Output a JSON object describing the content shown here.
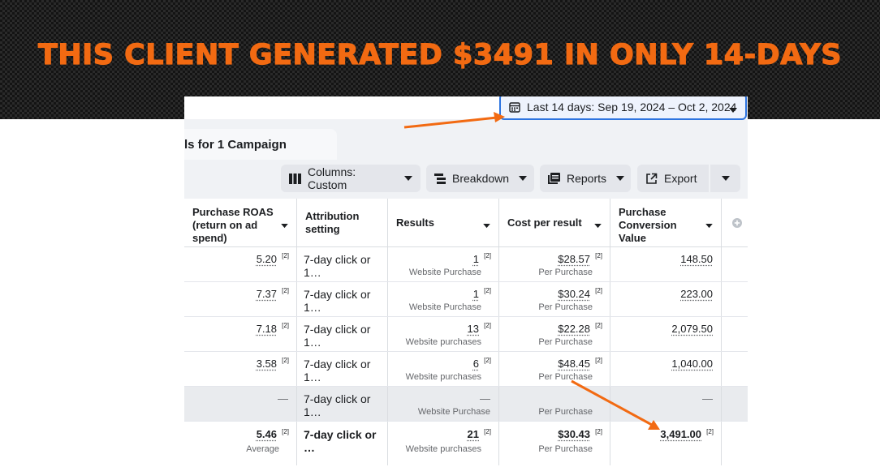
{
  "headline": "THIS CLIENT GENERATED $3491 IN ONLY 14-DAYS",
  "date_range": {
    "label": "Last 14 days: Sep 19, 2024 – Oct 2, 2024"
  },
  "tab": {
    "label": "ls for 1 Campaign"
  },
  "toolbar": {
    "columns_label": "Columns: Custom",
    "breakdown_label": "Breakdown",
    "reports_label": "Reports",
    "export_label": "Export"
  },
  "table": {
    "headers": [
      "Purchase ROAS (return on ad spend)",
      "Attribution setting",
      "Results",
      "Cost per result",
      "Purchase Conversion Value"
    ],
    "footnote_marker": "[2]",
    "rows": [
      {
        "roas": "5.20",
        "attribution": "7-day click or 1…",
        "results": "1",
        "results_sub": "Website Purchase",
        "cost": "$28.57",
        "cost_sub": "Per Purchase",
        "value": "148.50"
      },
      {
        "roas": "7.37",
        "attribution": "7-day click or 1…",
        "results": "1",
        "results_sub": "Website Purchase",
        "cost": "$30.24",
        "cost_sub": "Per Purchase",
        "value": "223.00"
      },
      {
        "roas": "7.18",
        "attribution": "7-day click or 1…",
        "results": "13",
        "results_sub": "Website purchases",
        "cost": "$22.28",
        "cost_sub": "Per Purchase",
        "value": "2,079.50"
      },
      {
        "roas": "3.58",
        "attribution": "7-day click or 1…",
        "results": "6",
        "results_sub": "Website purchases",
        "cost": "$48.45",
        "cost_sub": "Per Purchase",
        "value": "1,040.00"
      },
      {
        "roas": "—",
        "attribution": "7-day click or 1…",
        "results": "—",
        "results_sub": "Website Purchase",
        "cost": "",
        "cost_sub": "Per Purchase",
        "value": "—"
      }
    ],
    "total": {
      "roas": "5.46",
      "roas_sub": "Average",
      "attribution": "7-day click or …",
      "results": "21",
      "results_sub": "Website purchases",
      "cost": "$30.43",
      "cost_sub": "Per Purchase",
      "value": "3,491.00"
    }
  },
  "colors": {
    "accent_orange": "#f26a12",
    "selection_blue": "#2d74e0"
  },
  "icons": [
    "calendar-icon",
    "caret-down-icon",
    "columns-icon",
    "breakdown-icon",
    "reports-icon",
    "export-icon",
    "add-column-icon",
    "arrow-annotation"
  ]
}
